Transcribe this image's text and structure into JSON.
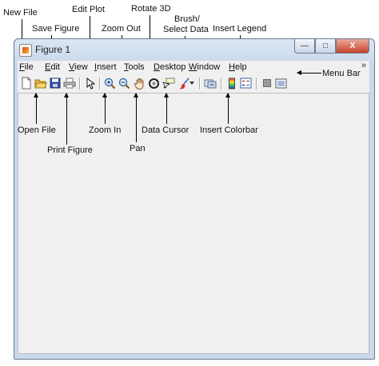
{
  "window": {
    "title": "Figure 1",
    "controls": {
      "minimize": "—",
      "maximize": "□",
      "close": "X"
    }
  },
  "menubar": {
    "items": [
      {
        "key": "F",
        "rest": "ile"
      },
      {
        "key": "E",
        "rest": "dit"
      },
      {
        "key": "V",
        "rest": "iew"
      },
      {
        "key": "I",
        "rest": "nsert"
      },
      {
        "key": "T",
        "rest": "ools"
      },
      {
        "key": "D",
        "rest": "esktop"
      },
      {
        "key": "W",
        "rest": "indow"
      },
      {
        "key": "H",
        "rest": "elp"
      }
    ],
    "overflow": "»"
  },
  "toolbar": {
    "tools": [
      {
        "name": "new-file",
        "icon": "new-file-icon"
      },
      {
        "name": "open-file",
        "icon": "open-folder-icon"
      },
      {
        "name": "save-figure",
        "icon": "save-disk-icon"
      },
      {
        "name": "print-figure",
        "icon": "printer-icon"
      },
      {
        "name": "edit-plot",
        "icon": "pointer-arrow-icon"
      },
      {
        "name": "zoom-in",
        "icon": "zoom-in-icon"
      },
      {
        "name": "zoom-out",
        "icon": "zoom-out-icon"
      },
      {
        "name": "pan",
        "icon": "hand-icon"
      },
      {
        "name": "rotate-3d",
        "icon": "rotate-icon"
      },
      {
        "name": "data-cursor",
        "icon": "data-cursor-icon"
      },
      {
        "name": "brush-select-data",
        "icon": "brush-icon"
      },
      {
        "name": "insert-colorbar",
        "icon": "colorbar-icon"
      },
      {
        "name": "insert-legend",
        "icon": "legend-icon"
      },
      {
        "name": "hide-plot-tools",
        "icon": "plot-tools-off-icon"
      },
      {
        "name": "show-plot-tools",
        "icon": "plot-tools-on-icon"
      }
    ]
  },
  "labels": {
    "new_file": "New File",
    "save_figure": "Save Figure",
    "edit_plot": "Edit Plot",
    "zoom_out": "Zoom Out",
    "rotate_3d": "Rotate 3D",
    "brush_1": "Brush/",
    "brush_2": "Select Data",
    "insert_legend": "Insert Legend",
    "menu_bar": "Menu Bar",
    "open_file": "Open File",
    "print_figure": "Print Figure",
    "zoom_in": "Zoom In",
    "pan": "Pan",
    "data_cursor": "Data Cursor",
    "insert_colorbar": "Insert Colorbar"
  },
  "colors": {
    "title_gradient_top": "#dbe6f3",
    "close_button": "#c7432d",
    "toolbar_bg": "#f0f0f0"
  }
}
